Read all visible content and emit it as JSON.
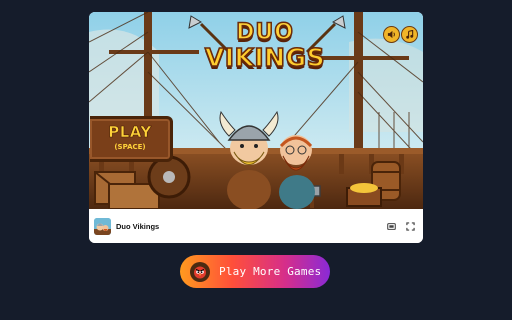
{
  "game": {
    "logo_line1": "DUO",
    "logo_line2": "VIKINGS",
    "play_label": "PLAY",
    "play_hint": "(SPACE)",
    "sound_icon": "speaker-icon",
    "music_icon": "music-note-icon"
  },
  "info_bar": {
    "title": "Duo Vikings",
    "icons": [
      "theater-mode-icon",
      "fullscreen-icon"
    ]
  },
  "cta": {
    "label": "Play More Games",
    "badge_icon": "angry-bird-icon"
  },
  "colors": {
    "page_background": "#151c2b",
    "card_background": "#ffffff",
    "logo_yellow": "#ffd23a",
    "sign_brown": "#7a3f19",
    "cta_gradient_start": "#ff9a1f",
    "cta_gradient_end": "#8a2ad6"
  }
}
